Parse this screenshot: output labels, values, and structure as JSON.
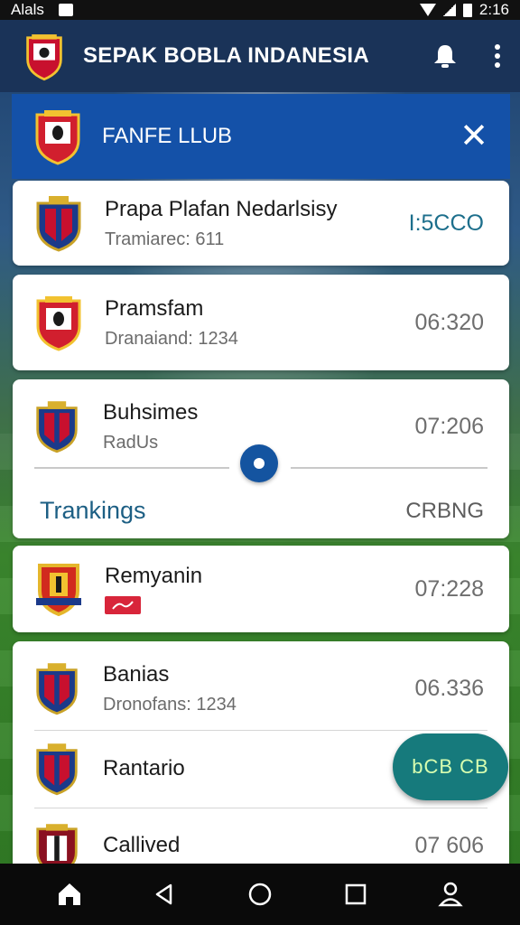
{
  "status_bar": {
    "carrier": "Alals",
    "time": "2:16"
  },
  "app_bar": {
    "title": "SEPAK BOBLA INDANESIA"
  },
  "club_header": {
    "name": "FANFE LLUB"
  },
  "matches_top": [
    {
      "name": "Prapa Plafan Nedarlsisy",
      "sub": "Tramiarec: 611",
      "time": "I:5CCO",
      "crest": "blue-red-crest"
    },
    {
      "name": "Pramsfam",
      "sub": "Dranaiand: 1234",
      "time": "06:320",
      "crest": "red-crest"
    }
  ],
  "match_section": {
    "name": "Buhsimes",
    "sub": "RadUs",
    "time": "07:206",
    "crest": "blue-red-crest"
  },
  "rankings": {
    "title": "Trankings",
    "action": "CRBNG"
  },
  "match_card": {
    "name": "Remyanin",
    "time": "07:228",
    "crest": "gold-red-crest"
  },
  "list": [
    {
      "name": "Banias",
      "sub": "Dronofans: 1234",
      "time": "06.336",
      "crest": "blue-red-crest"
    },
    {
      "name": "Rantario",
      "sub": "",
      "time": "",
      "crest": "blue-red-crest"
    },
    {
      "name": "Callived",
      "sub": "",
      "time": "07 606",
      "crest": "dark-red-crest"
    }
  ],
  "fab": {
    "label": "bCB CB"
  },
  "nav": [
    "home-icon",
    "back-icon",
    "home-circle-icon",
    "recents-icon",
    "profile-icon"
  ],
  "colors": {
    "app_bar": "#1a3358",
    "header": "#1451a8",
    "accent": "#1d5f84",
    "fab": "#167a7c"
  }
}
